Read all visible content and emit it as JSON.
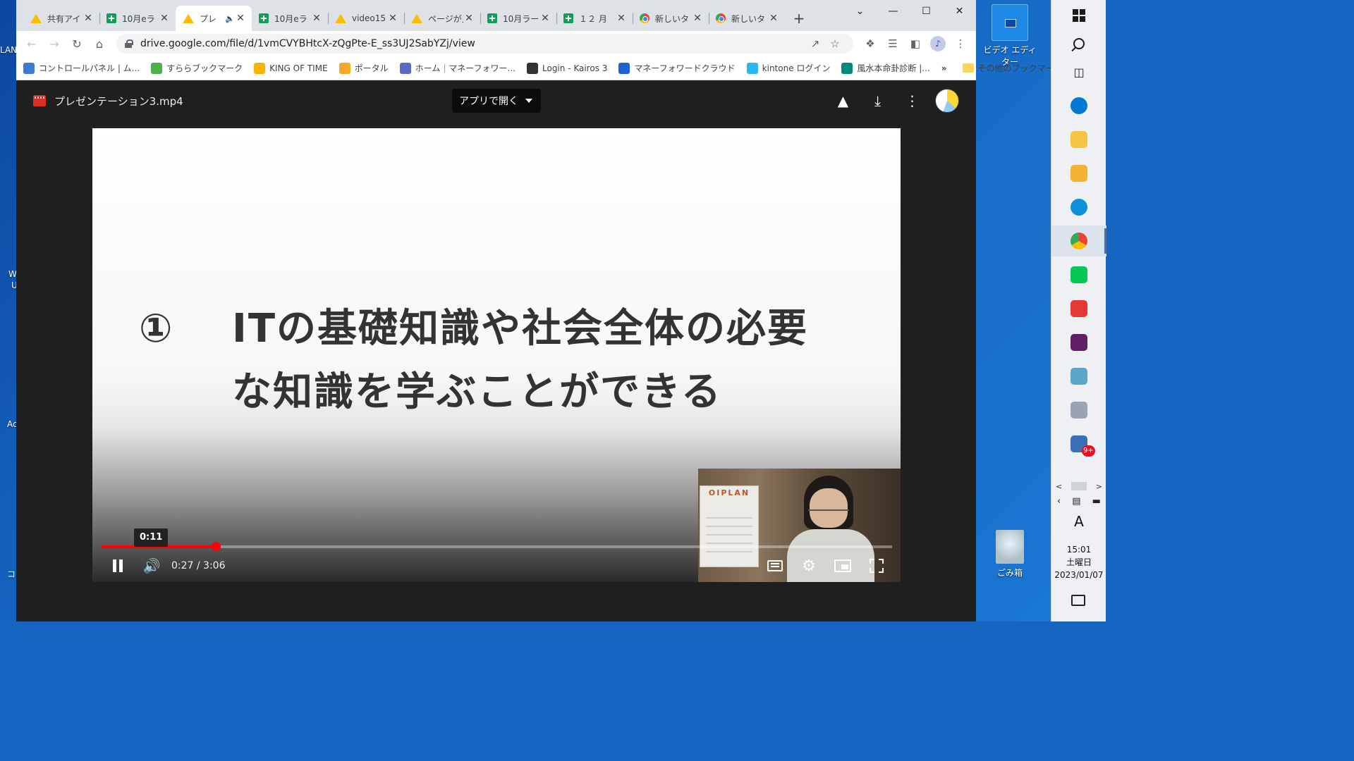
{
  "desktop": {
    "edge_labels": [
      {
        "text": "LAN"
      },
      {
        "text": "W"
      },
      {
        "text": "U"
      },
      {
        "text": "Ac"
      },
      {
        "text": "コン"
      }
    ],
    "icons": {
      "video_editor": "ビデオ エディター",
      "recycle_bin": "ごみ箱"
    }
  },
  "browser": {
    "tabs": [
      {
        "title": "共有アイ",
        "icon": "drive-icon"
      },
      {
        "title": "10月eラ",
        "icon": "sheets-icon"
      },
      {
        "title": "プレ",
        "icon": "drive-icon",
        "active": true,
        "muted_indicator": "🔈"
      },
      {
        "title": "10月eラ",
        "icon": "sheets-icon"
      },
      {
        "title": "video15",
        "icon": "drive-icon"
      },
      {
        "title": "ページが見",
        "icon": "drive-icon"
      },
      {
        "title": "10月ラー",
        "icon": "sheets-icon"
      },
      {
        "title": "１２ 月",
        "icon": "sheets-icon"
      },
      {
        "title": "新しいタ",
        "icon": "chrome-icon"
      },
      {
        "title": "新しいタ",
        "icon": "chrome-icon"
      }
    ],
    "tab_close_glyph": "✕",
    "new_tab_glyph": "+",
    "window_controls": {
      "dropdown": "⌄",
      "minimize": "—",
      "maximize": "☐",
      "close": "✕"
    },
    "url": "drive.google.com/file/d/1vmCVYBHtcX-zQgPte-E_ss3UJ2SabYZj/view",
    "bookmarks": [
      {
        "label": "コントロールパネル | ム...",
        "color": "#3d7bd9"
      },
      {
        "label": "すららブックマーク",
        "color": "#4caf50"
      },
      {
        "label": "KING OF TIME",
        "color": "#f4b400"
      },
      {
        "label": "ポータル",
        "color": "#f9a825"
      },
      {
        "label": "ホーム｜マネーフォワー...",
        "color": "#5c6bc0"
      },
      {
        "label": "Login - Kairos 3",
        "color": "#333333"
      },
      {
        "label": "マネーフォワードクラウド",
        "color": "#1e63d6"
      },
      {
        "label": "kintone ログイン",
        "color": "#29b6f6"
      },
      {
        "label": "風水本命卦診断 |...",
        "color": "#00897b"
      }
    ],
    "bookmarks_overflow": "»",
    "other_bookmarks": "その他のブックマーク"
  },
  "viewer": {
    "file_name": "プレゼンテーション3.mp4",
    "open_with": "アプリで開く",
    "slide": {
      "number": "①",
      "line1": "ITの基礎知識や社会全体の必要",
      "line2": "な知識を学ぶことができる"
    },
    "calendar_text": "OIPLAN",
    "player": {
      "hover_time": "0:11",
      "current_time": "0:27",
      "duration": "3:06",
      "time_display": "0:27 / 3:06",
      "progress_fraction": 0.145
    }
  },
  "taskbar": {
    "badge": "9+",
    "ime": "A",
    "time": "15:01",
    "weekday": "土曜日",
    "date": "2023/01/07",
    "app_colors": [
      "#0078d4",
      "#f6c343",
      "#f2b233",
      "#0f8fd8",
      "#e8e8e8",
      "#06c755",
      "#e53935",
      "#611f69",
      "#5aa6c8",
      "#9aa3b5",
      "#3b6fb6"
    ]
  }
}
